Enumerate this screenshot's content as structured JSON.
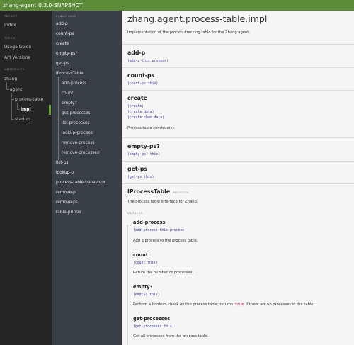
{
  "topbar": {
    "project": "zhang-agent",
    "version": "0.3.0-SNAPSHOT"
  },
  "left": {
    "project_label": "PROJECT",
    "index": "Index",
    "topics_label": "TOPICS",
    "usage_guide": "Usage Guide",
    "api_versions": "API Versions",
    "namespaces_label": "NAMESPACES",
    "ns_zhang": "zhang",
    "ns_agent": "agent",
    "ns_process_table": "process-table",
    "ns_impl": "impl",
    "ns_startup": "startup"
  },
  "mid": {
    "public_vars_label": "PUBLIC VARS",
    "items": [
      "add-p",
      "count-ps",
      "create",
      "empty-ps?",
      "get-ps",
      "IProcessTable",
      "add-process",
      "count",
      "empty?",
      "get-processes",
      "list-processes",
      "lookup-process",
      "remove-process",
      "remove-processes",
      "list-ps",
      "lookup-p",
      "process-table-behaviour",
      "remove-p",
      "remove-ps",
      "table-printer"
    ]
  },
  "main": {
    "title": "zhang.agent.process-table.impl",
    "description": "Implementation of the process-tracking table for the Zhang agent.",
    "add_p": {
      "name": "add-p",
      "usage": "(add-p this process)"
    },
    "count_ps": {
      "name": "count-ps",
      "usage": "(count-ps this)"
    },
    "create": {
      "name": "create",
      "usage1": "(create)",
      "usage2": "(create data)",
      "usage3": "(create chan data)",
      "doc": "Process table constructor."
    },
    "empty_ps": {
      "name": "empty-ps?",
      "usage": "(empty-ps? this)"
    },
    "get_ps": {
      "name": "get-ps",
      "usage": "(get-ps this)"
    },
    "iprocess": {
      "name": "IProcessTable",
      "badge": "PROTOCOL",
      "doc": "The process table interface for Zhang."
    },
    "members_label": "MEMBERS",
    "add_process": {
      "name": "add-process",
      "usage": "(add-process this process)",
      "doc": "Add a process to the process table."
    },
    "count": {
      "name": "count",
      "usage": "(count this)",
      "doc": "Return the number of processes."
    },
    "empty": {
      "name": "empty?",
      "usage": "(empty? this)",
      "doc_a": "Perform a boolean check on the process table; returns",
      "doc_true": "true",
      "doc_b": "if there are no processes in the table."
    },
    "get_processes": {
      "name": "get-processes",
      "usage": "(get-processes this)",
      "doc": "Get all processes from the process table."
    }
  }
}
